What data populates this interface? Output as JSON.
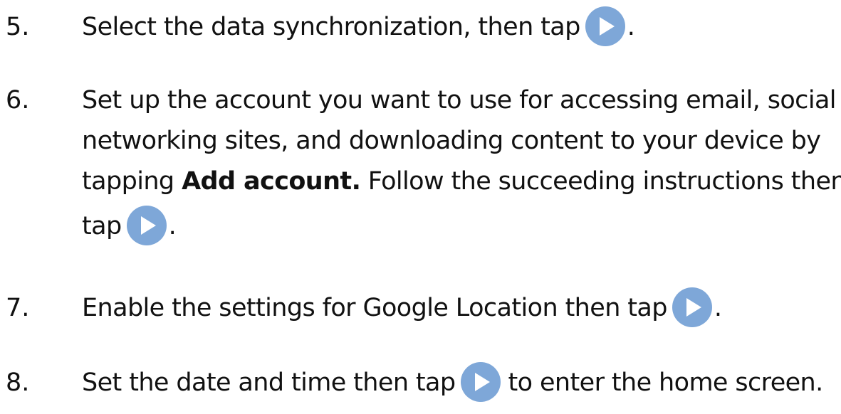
{
  "steps": [
    {
      "number": "5.",
      "text_before": "Select the data synchronization, then tap",
      "text_after": "."
    },
    {
      "number": "6.",
      "line1": "Set up the account you want to use for accessing email, social",
      "line2": "networking sites, and downloading content to your device by",
      "line3_pre": "tapping",
      "line3_bold": "Add account.",
      "line3_post": "Follow the succeeding instructions then",
      "line4_pre": "tap",
      "line4_post": "."
    },
    {
      "number": "7.",
      "text_before": "Enable the settings for Google Location then tap",
      "text_after": "."
    },
    {
      "number": "8.",
      "text_before": "Set the date and time then tap",
      "text_after": "to enter the home screen."
    }
  ],
  "icon": {
    "name": "next-arrow-icon",
    "circle_color": "#7ea7d8",
    "arrow_color": "#ffffff"
  }
}
